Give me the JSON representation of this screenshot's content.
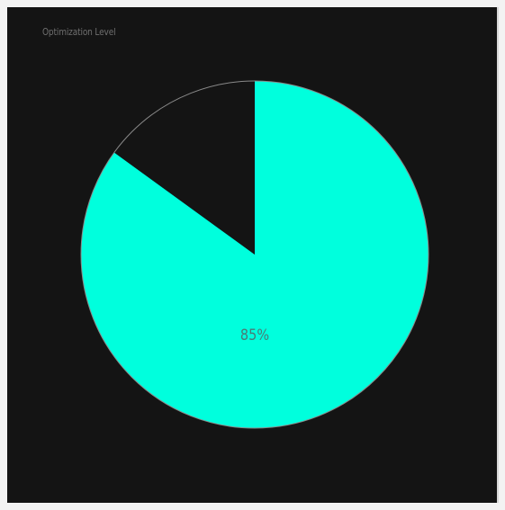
{
  "chart_data": {
    "type": "pie",
    "title": "Optimization Level",
    "values": [
      85,
      15
    ],
    "value_label": "85%",
    "colors": {
      "filled": "#00ffdd",
      "remainder": "#141414",
      "outline": "#8a8a8a",
      "background": "#141414",
      "label": "#4a7a76",
      "title": "#6f6f6f"
    }
  }
}
